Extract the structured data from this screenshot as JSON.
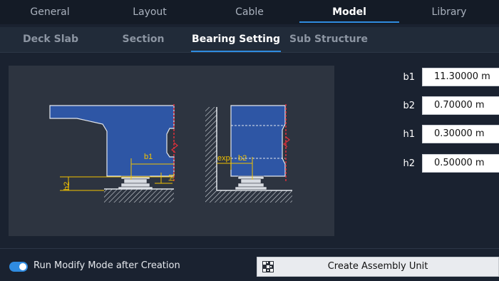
{
  "main_tabs": [
    {
      "label": "General",
      "active": false
    },
    {
      "label": "Layout",
      "active": false
    },
    {
      "label": "Cable",
      "active": false
    },
    {
      "label": "Model",
      "active": true
    },
    {
      "label": "Library",
      "active": false
    }
  ],
  "sub_tabs": [
    {
      "label": "Deck Slab",
      "active": false
    },
    {
      "label": "Section",
      "active": false
    },
    {
      "label": "Bearing Setting",
      "active": true
    },
    {
      "label": "Sub Structure",
      "active": false
    }
  ],
  "diagram": {
    "labels": {
      "b1": "b1",
      "b2": "b2",
      "h1": "h1",
      "h2": "h2",
      "exp": "exp"
    }
  },
  "params": [
    {
      "label": "b1",
      "value": "11.30000 m"
    },
    {
      "label": "b2",
      "value": "0.70000 m"
    },
    {
      "label": "h1",
      "value": "0.30000 m"
    },
    {
      "label": "h2",
      "value": "0.50000 m"
    }
  ],
  "bottom": {
    "toggle_label": "Run Modify Mode after Creation",
    "toggle_on": true,
    "create_button_label": "Create Assembly Unit",
    "create_icon": "assembly-grid-icon"
  },
  "colors": {
    "accent": "#2f8be0",
    "deck_fill": "#2e56a5",
    "dimension": "#f2c200",
    "cut_line": "#e0303a"
  }
}
